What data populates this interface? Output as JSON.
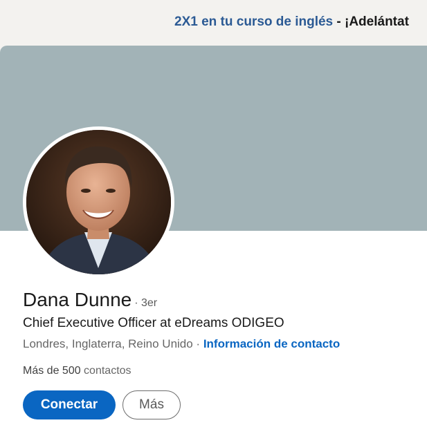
{
  "promo": {
    "link_text": "2X1 en tu curso de inglés",
    "rest_text": " - ¡Adelántat"
  },
  "profile": {
    "name": "Dana Dunne",
    "degree": "· 3er",
    "headline": "Chief Executive Officer at eDreams ODIGEO",
    "location": "Londres, Inglaterra, Reino Unido",
    "separator": " · ",
    "contact_link": "Información de contacto",
    "connections_count": "Más de 500",
    "connections_label": " contactos",
    "avatar_icon": "profile-photo"
  },
  "actions": {
    "connect_label": "Conectar",
    "more_label": "Más"
  },
  "colors": {
    "cover": "#a2b3b7",
    "primary": "#0a66c2",
    "promo_link": "#2b5a94"
  }
}
